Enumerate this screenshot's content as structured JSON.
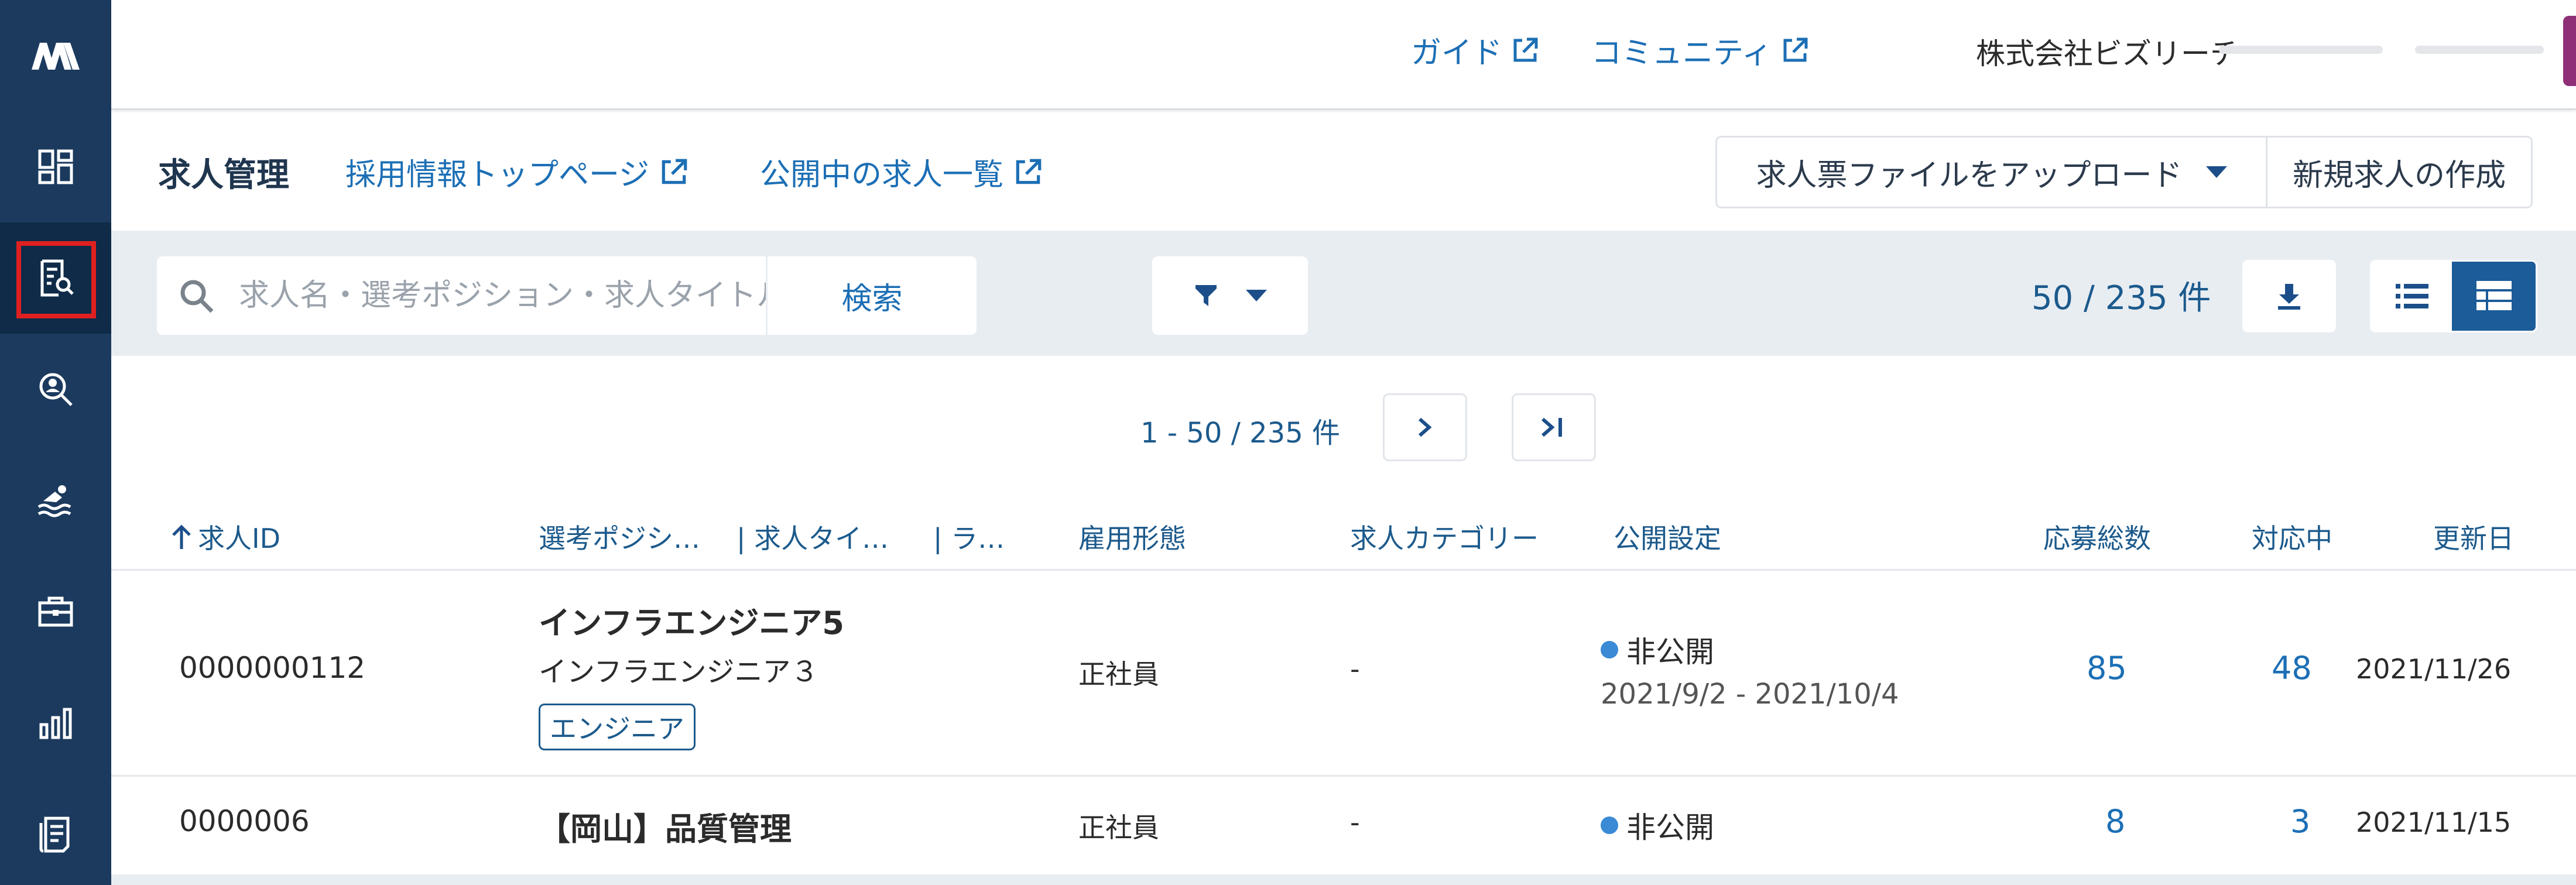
{
  "header": {
    "links": [
      {
        "label": "ガイド"
      },
      {
        "label": "コミュニティ"
      }
    ],
    "company": "株式会社ビズリーチ"
  },
  "subheader": {
    "title": "求人管理",
    "links": [
      {
        "label": "採用情報トップページ"
      },
      {
        "label": "公開中の求人一覧"
      }
    ],
    "upload_label": "求人票ファイルをアップロード",
    "create_label": "新規求人の作成"
  },
  "search": {
    "placeholder": "求人名・選考ポジション・求人タイトルで検索",
    "button_label": "検索",
    "count": "50 / 235 件"
  },
  "pagination": {
    "range": "1 - 50 / 235 件",
    "next": "›",
    "last": ">|"
  },
  "table": {
    "columns": {
      "id": "求人ID",
      "position": "選考ポジシ…",
      "title": "| 求人タイ…",
      "label": "| ラ…",
      "employment": "雇用形態",
      "category": "求人カテゴリー",
      "visibility": "公開設定",
      "applications": "応募総数",
      "in_progress": "対応中",
      "updated": "更新日"
    },
    "rows": [
      {
        "id": "0000000112",
        "position": "インフラエンジニア5",
        "title": "インフラエンジニア３",
        "tag": "エンジニア",
        "employment": "正社員",
        "category": "-",
        "status": "非公開",
        "period": "2021/9/2 - 2021/10/4",
        "applications": "85",
        "in_progress": "48",
        "updated": "2021/11/26"
      },
      {
        "id": "0000006",
        "position": "【岡山】品質管理",
        "employment": "正社員",
        "category": "-",
        "status": "非公開",
        "applications": "8",
        "in_progress": "3",
        "updated": "2021/11/15"
      }
    ]
  },
  "colors": {
    "sidebar": "#1b3a5e",
    "link": "#1c6fb5",
    "accent": "#1b5c99",
    "highlight": "#e02020"
  },
  "icons": [
    "logo-icon",
    "dashboard-icon",
    "job-search-icon",
    "candidate-search-icon",
    "swimmer-icon",
    "briefcase-icon",
    "bar-chart-icon",
    "document-icon",
    "external-link-icon",
    "search-icon",
    "filter-icon",
    "download-icon",
    "list-view-icon",
    "table-view-icon",
    "sort-up-icon"
  ]
}
